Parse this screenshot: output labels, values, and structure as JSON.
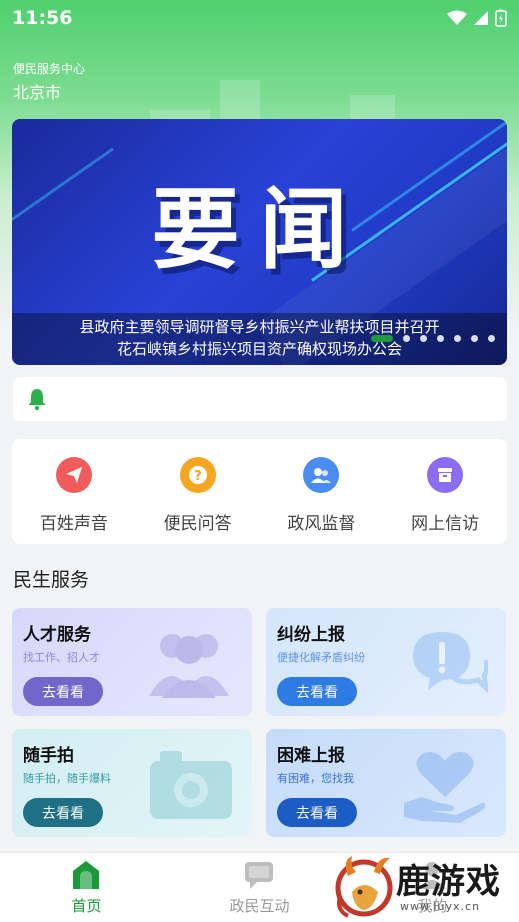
{
  "status_bar": {
    "time": "11:56"
  },
  "header": {
    "subtitle": "便民服务中心",
    "city": "北京市"
  },
  "banner": {
    "title": "要闻",
    "caption_line1": "县政府主要领导调研督导乡村振兴产业帮扶项目并召开",
    "caption_line2": "花石峡镇乡村振兴项目资产确权现场办公会",
    "dot_count": 7,
    "active_dot": 0
  },
  "notice": {
    "icon": "bell-icon",
    "text": ""
  },
  "quick_actions": [
    {
      "label": "百姓声音",
      "icon": "paper-plane-icon",
      "color": "#f05b5b"
    },
    {
      "label": "便民问答",
      "icon": "question-icon",
      "color": "#f5a623"
    },
    {
      "label": "政风监督",
      "icon": "users-icon",
      "color": "#4a8cf0"
    },
    {
      "label": "网上信访",
      "icon": "archive-icon",
      "color": "#8c6cf0"
    }
  ],
  "services": {
    "title": "民生服务",
    "cards": [
      {
        "title": "人才服务",
        "subtitle": "找工作、招人才",
        "button": "去看看",
        "icon": "people-icon"
      },
      {
        "title": "纠纷上报",
        "subtitle": "便捷化解矛盾纠纷",
        "button": "去看看",
        "icon": "alert-chat-icon"
      },
      {
        "title": "随手拍",
        "subtitle": "随手拍，随手爆料",
        "button": "去看看",
        "icon": "camera-icon"
      },
      {
        "title": "困难上报",
        "subtitle": "有困难，您找我",
        "button": "去看看",
        "icon": "heart-hand-icon"
      }
    ]
  },
  "bottom_nav": [
    {
      "label": "首页",
      "icon": "home-icon",
      "active": true
    },
    {
      "label": "政民互动",
      "icon": "chat-icon",
      "active": false
    },
    {
      "label": "我的",
      "icon": "user-icon",
      "active": false
    }
  ],
  "watermark": {
    "text": "鹿游戏",
    "url": "www.luyx.cn"
  },
  "colors": {
    "accent": "#1a9a3a",
    "card_text_purple": "#6f67d8",
    "card_text_blue": "#3a80e0",
    "card_text_teal": "#2a8f9a"
  }
}
